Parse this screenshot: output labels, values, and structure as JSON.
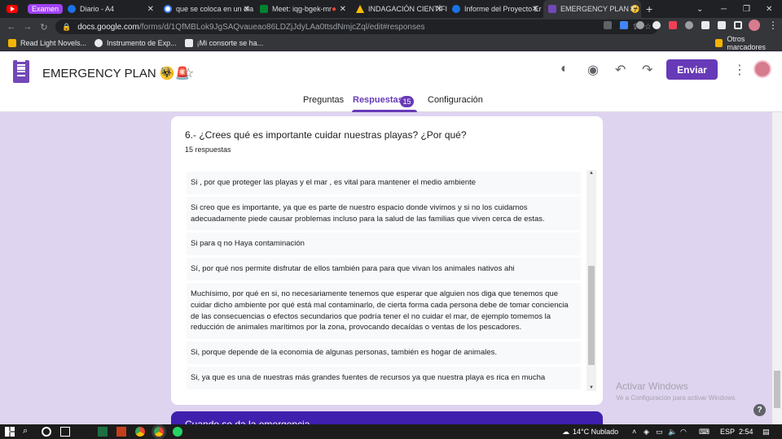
{
  "browser": {
    "tab_group": "Examen",
    "tabs": [
      {
        "title": "Diario - A4",
        "color": "#1a73e8"
      },
      {
        "title": "que se coloca en un dia",
        "color": "#ffffff"
      },
      {
        "title": "Meet: iqg-bgek-mr",
        "color": "#00832d"
      },
      {
        "title": "INDAGACIÓN CIENTÍFIC",
        "color": "#fbbc04"
      },
      {
        "title": "Informe del Proyecto Er",
        "color": "#1a73e8"
      },
      {
        "title": "EMERGENCY PLAN ☣️ 🚨",
        "color": "#7248b9"
      }
    ],
    "new_tab": "+",
    "url_host": "docs.google.com",
    "url_path": "/forms/d/1QfMBLok9JgSAQvaueao86LDZjJdyLAa0ttsdNmjcZql/edit#responses",
    "bookmarks": [
      {
        "label": "Read Light Novels...",
        "color": "#f4b400"
      },
      {
        "label": "Instrumento de Exp...",
        "color": "#e8eaed"
      },
      {
        "label": "¡Mi consorte se ha...",
        "color": "#e8eaed"
      }
    ],
    "other_bookmarks": "Otros marcadores"
  },
  "form": {
    "title": "EMERGENCY PLAN ☣️🚨",
    "send_label": "Enviar",
    "tabs": {
      "questions": "Preguntas",
      "responses": "Respuestas",
      "settings": "Configuración"
    },
    "responses_count": "15"
  },
  "question": {
    "title": "6.- ¿Crees qué es importante cuidar nuestras playas? ¿Por qué?",
    "count_text": "15 respuestas",
    "responses": [
      "Si , por que proteger las playas y el mar , es vital para mantener el medio ambiente",
      "Si creo que es importante, ya que es parte de nuestro espacio donde vivimos y si no los cuidamos adecuadamente piede causar problemas incluso para la salud de las familias que viven cerca de estas.",
      "Si para q no Haya contaminación",
      "Sí, por qué nos permite disfrutar de ellos también para para que vivan los animales nativos ahi",
      "Muchísimo, por qué en si, no necesariamente tenemos que esperar que alguien nos diga que tenemos que cuidar dicho ambiente por qué está mal contaminarlo, de cierta forma cada persona debe de tomar conciencia de las consecuencias o efectos secundarios que podría tener el no cuidar el mar, de ejemplo tomemos la reducción de animales marítimos por la zona, provocando decaídas o ventas de los pescadores.",
      "Si, porque depende de la economia de algunas personas, también es hogar de animales.",
      "Si, ya que es una de nuestras más grandes fuentes de recursos ya que nuestra playa es rica en mucha"
    ]
  },
  "next_card_title": "Cuando se da la emergencia",
  "watermark": {
    "line1": "Activar Windows",
    "line2": "Ve a Configuración para activar Windows."
  },
  "taskbar": {
    "weather": "14°C Nublado",
    "lang": "ESP",
    "time": "2:54"
  }
}
